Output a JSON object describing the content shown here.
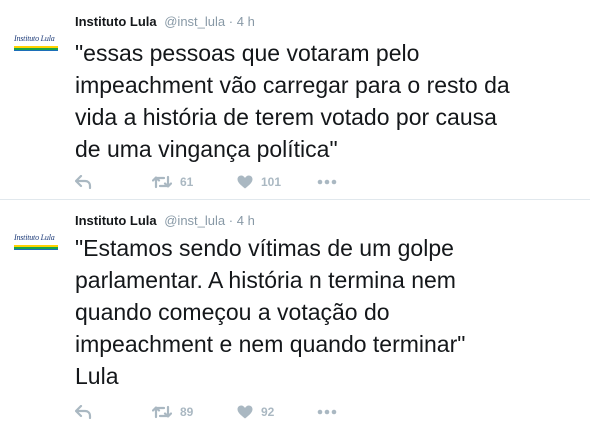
{
  "tweets": [
    {
      "avatar_text": "Instituto Lula",
      "name": "Instituto Lula",
      "handle": "@inst_lula",
      "separator": "·",
      "time": "4 h",
      "text": "\"essas pessoas que votaram pelo\nimpeachment vão carregar para o resto da\nvida a história de terem votado por causa\nde uma vingança política\"",
      "retweets": "61",
      "likes": "101"
    },
    {
      "avatar_text": "Instituto Lula",
      "name": "Instituto Lula",
      "handle": "@inst_lula",
      "separator": "·",
      "time": "4 h",
      "text": "\"Estamos sendo vítimas de um golpe\nparlamentar. A história n termina nem\nquando começou a votação do\nimpeachment e nem quando terminar\"\nLula",
      "retweets": "89",
      "likes": "92"
    }
  ],
  "icons": {
    "reply": "reply-icon",
    "retweet": "retweet-icon",
    "like": "heart-icon",
    "more": "more-icon"
  },
  "colors": {
    "text": "#14171a",
    "muted": "#8899a6",
    "icon": "#aab8c2",
    "divider": "#e1e8ed"
  }
}
